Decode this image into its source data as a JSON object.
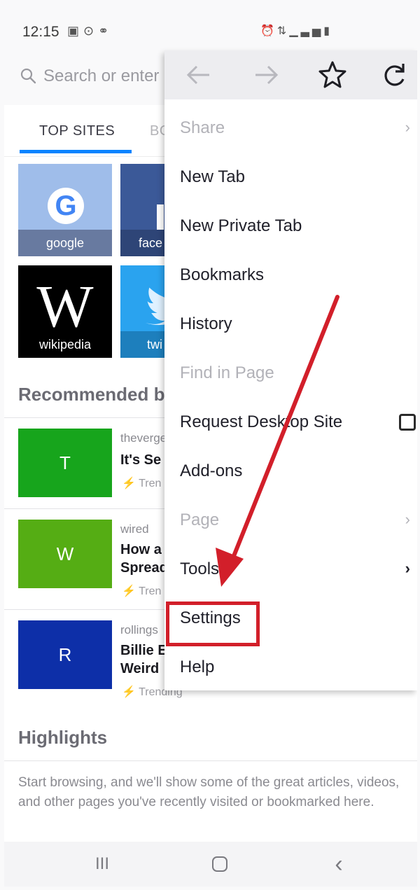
{
  "status_bar": {
    "time": "12:15",
    "left_icons": [
      "image-icon",
      "sync-icon",
      "voicemail-icon"
    ],
    "right_icons": [
      "alarm-icon",
      "wifi-icon",
      "signal-icon",
      "battery-icon"
    ]
  },
  "url_bar": {
    "placeholder": "Search or enter address",
    "visible_text": "Search or enter"
  },
  "tabs": {
    "top_sites": "TOP SITES",
    "bookmarks": "BO"
  },
  "top_sites": [
    {
      "label": "google",
      "icon": "google-icon"
    },
    {
      "label": "face",
      "icon": "facebook-icon"
    },
    {
      "label": "wikipedia",
      "icon": "wikipedia-icon"
    },
    {
      "label": "twi",
      "icon": "twitter-icon"
    }
  ],
  "recommended": {
    "title": "Recommended b",
    "items": [
      {
        "letter": "T",
        "color": "#17a51c",
        "source": "theverge",
        "title": "It's Se",
        "trend": "Tren"
      },
      {
        "letter": "W",
        "color": "#55ad14",
        "source": "wired",
        "title": "How a\nSpread",
        "trend": "Tren"
      },
      {
        "letter": "R",
        "color": "#0d2fa8",
        "source": "rollings",
        "title": "Billie E\nWeird",
        "trend": "Trending"
      }
    ]
  },
  "highlights": {
    "title": "Highlights",
    "description": "Start browsing, and we'll show some of the great articles, videos, and other pages you've recently visited or bookmarked here."
  },
  "menu": {
    "toolbar": [
      "back-icon",
      "forward-icon",
      "star-icon",
      "reload-icon"
    ],
    "items": [
      {
        "label": "Share",
        "disabled": true
      },
      {
        "label": "New Tab",
        "disabled": false
      },
      {
        "label": "New Private Tab",
        "disabled": false
      },
      {
        "label": "Bookmarks",
        "disabled": false
      },
      {
        "label": "History",
        "disabled": false
      },
      {
        "label": "Find in Page",
        "disabled": true
      },
      {
        "label": "Request Desktop Site",
        "disabled": false
      },
      {
        "label": "Add-ons",
        "disabled": false
      },
      {
        "label": "Page",
        "disabled": true
      },
      {
        "label": "Tools",
        "disabled": false
      },
      {
        "label": "Settings",
        "disabled": false
      },
      {
        "label": "Help",
        "disabled": false
      }
    ],
    "chevron": "›"
  },
  "annotation": {
    "arrow_color": "#d21f2a",
    "highlight_color": "#d21f2a"
  },
  "nav_bar": {
    "recents": "III",
    "back": "‹"
  }
}
